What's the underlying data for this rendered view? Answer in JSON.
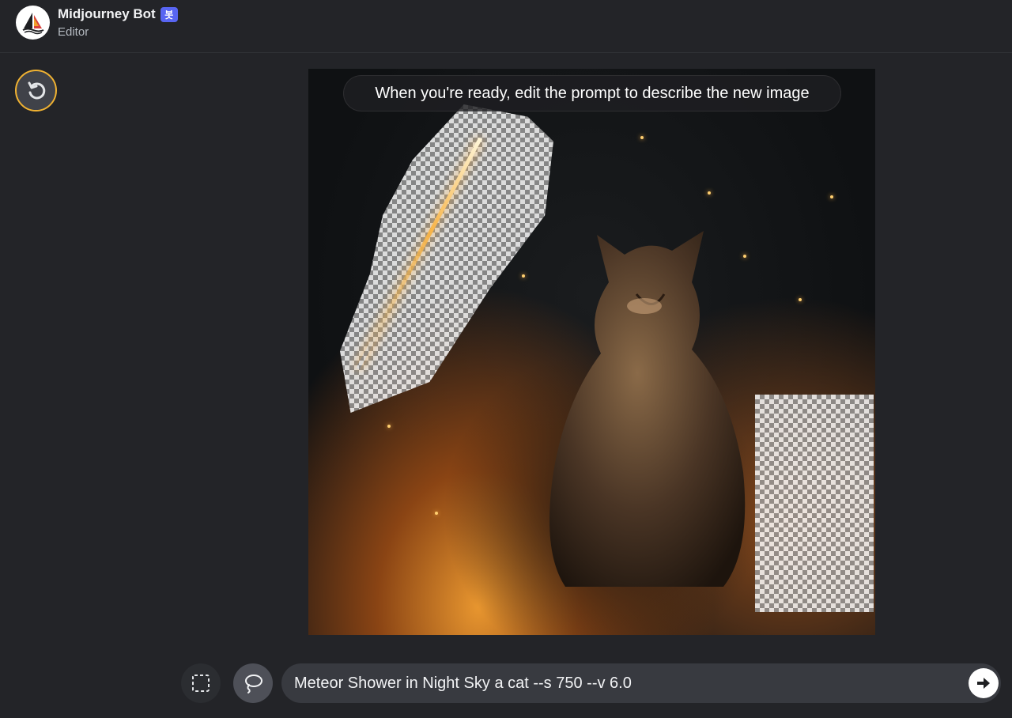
{
  "header": {
    "bot_name": "Midjourney Bot",
    "bot_badge": "봇",
    "subtitle": "Editor",
    "avatar_icon": "sailboat-logo-icon"
  },
  "editor": {
    "hint_text": "When you're ready, edit the prompt to describe the new image",
    "undo_icon": "undo-icon"
  },
  "toolbar": {
    "rect_select_icon": "rectangle-select-icon",
    "lasso_icon": "lasso-icon",
    "prompt_value": "Meteor Shower in Night Sky a cat --s 750 --v 6.0",
    "send_icon": "arrow-right-icon"
  },
  "colors": {
    "background": "#232428",
    "accent_ring": "#f0b232",
    "badge": "#5865f2",
    "prompt_bg": "#383a40"
  }
}
